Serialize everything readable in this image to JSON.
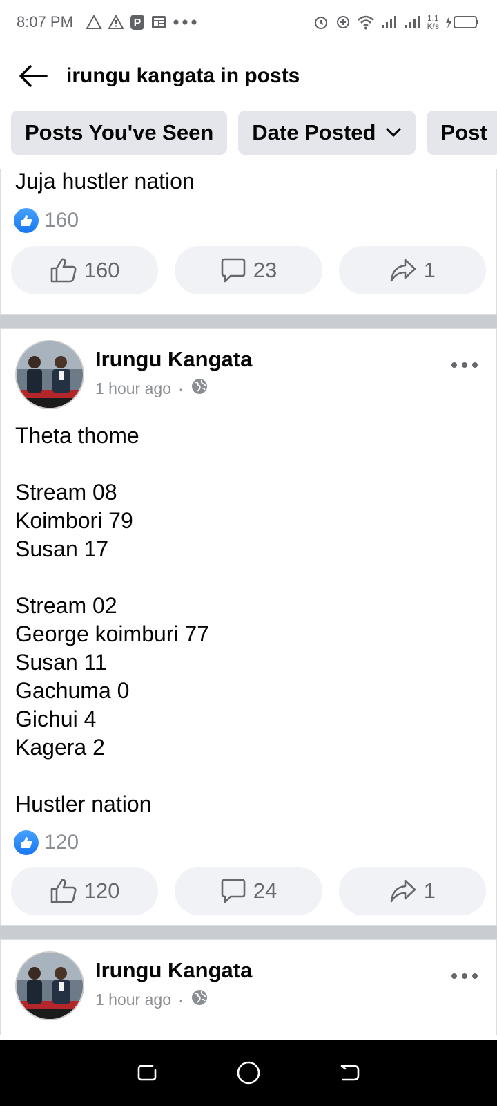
{
  "status_bar": {
    "time": "8:07 PM",
    "net_speed_value": "1.1",
    "net_speed_unit": "K/s"
  },
  "header": {
    "title": "irungu kangata in posts"
  },
  "filters": [
    {
      "label": "Posts You've Seen"
    },
    {
      "label": "Date Posted"
    },
    {
      "label": "Post"
    }
  ],
  "posts": [
    {
      "text": "Juja hustler nation",
      "reaction_count": "160",
      "like_count": "160",
      "comment_count": "23",
      "share_count": "1"
    },
    {
      "author": "Irungu Kangata",
      "time": "1 hour ago",
      "separator": "·",
      "text": "Theta thome\n\nStream 08\nKoimbori 79\nSusan 17\n\nStream 02\nGeorge koimburi 77\nSusan 11\nGachuma  0\nGichui 4\nKagera 2\n\nHustler nation",
      "reaction_count": "120",
      "like_count": "120",
      "comment_count": "24",
      "share_count": "1"
    },
    {
      "author": "Irungu Kangata",
      "time": "1 hour ago",
      "separator": "·"
    }
  ],
  "colors": {
    "accent": "#1877f2",
    "chip_bg": "#e4e6eb",
    "action_bg": "#f0f2f5",
    "divider": "#c9ccd1"
  }
}
